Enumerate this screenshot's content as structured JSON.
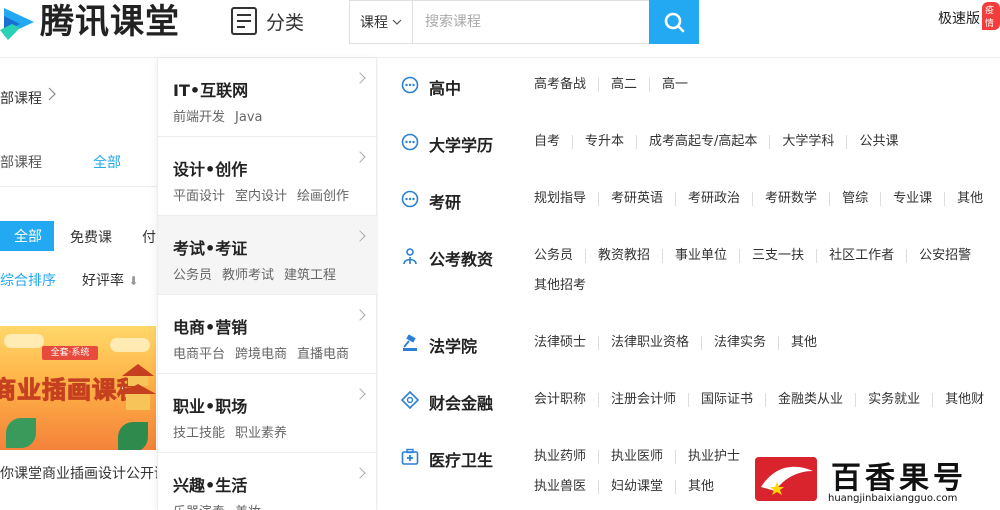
{
  "header": {
    "brand": "腾讯课堂",
    "category_label": "分类",
    "search_select": "课程",
    "search_placeholder": "搜索课程",
    "speed_label": "极速版",
    "speed_badge": "疫情"
  },
  "background": {
    "crumb": "部课程",
    "filter_label": "部课程",
    "filter_active": "全部",
    "tabs": [
      "全部",
      "免费课",
      "付"
    ],
    "sort_active": "综合排序",
    "sort_rate": "好评率",
    "course_title": "你课堂商业插画设计公开课",
    "thumb_ribbon": "全套·系统",
    "thumb_big": "商业插画课程"
  },
  "menu": {
    "categories": [
      {
        "name": "IT•互联网",
        "subs": [
          "前端开发",
          "Java"
        ]
      },
      {
        "name": "设计•创作",
        "subs": [
          "平面设计",
          "室内设计",
          "绘画创作"
        ]
      },
      {
        "name": "考试•考证",
        "subs": [
          "公务员",
          "教师考试",
          "建筑工程"
        ]
      },
      {
        "name": "电商•营销",
        "subs": [
          "电商平台",
          "跨境电商",
          "直播电商"
        ]
      },
      {
        "name": "职业•职场",
        "subs": [
          "技工技能",
          "职业素养"
        ]
      },
      {
        "name": "兴趣•生活",
        "subs": [
          "乐器演奏",
          "美妆"
        ]
      }
    ],
    "active_category": "考试•考证",
    "groups": [
      {
        "name": "高中",
        "icon": "dots-circle-icon",
        "lines": [
          [
            "高考备战",
            "高二",
            "高一"
          ]
        ]
      },
      {
        "name": "大学学历",
        "icon": "dots-circle-icon",
        "lines": [
          [
            "自考",
            "专升本",
            "成考高起专/高起本",
            "大学学科",
            "公共课"
          ]
        ]
      },
      {
        "name": "考研",
        "icon": "dots-circle-icon",
        "lines": [
          [
            "规划指导",
            "考研英语",
            "考研政治",
            "考研数学",
            "管综",
            "专业课",
            "其他"
          ]
        ]
      },
      {
        "name": "公考教资",
        "icon": "people-icon",
        "lines": [
          [
            "公务员",
            "教资教招",
            "事业单位",
            "三支一扶",
            "社区工作者",
            "公安招警"
          ],
          [
            "其他招考"
          ]
        ]
      },
      {
        "name": "法学院",
        "icon": "gavel-icon",
        "lines": [
          [
            "法律硕士",
            "法律职业资格",
            "法律实务",
            "其他"
          ]
        ]
      },
      {
        "name": "财会金融",
        "icon": "diamond-coin-icon",
        "lines": [
          [
            "会计职称",
            "注册会计师",
            "国际证书",
            "金融类从业",
            "实务就业",
            "其他财"
          ]
        ]
      },
      {
        "name": "医疗卫生",
        "icon": "medical-kit-icon",
        "lines": [
          [
            "执业药师",
            "执业医师",
            "执业护士"
          ],
          [
            "执业兽医",
            "妇幼课堂",
            "其他"
          ]
        ]
      }
    ]
  },
  "watermark": {
    "text": "百香果号",
    "url": "huangjinbaixiangguo.com"
  },
  "colors": {
    "accent": "#23a8f2",
    "badge": "#f23d3d",
    "watermark_red": "#d9232d"
  }
}
